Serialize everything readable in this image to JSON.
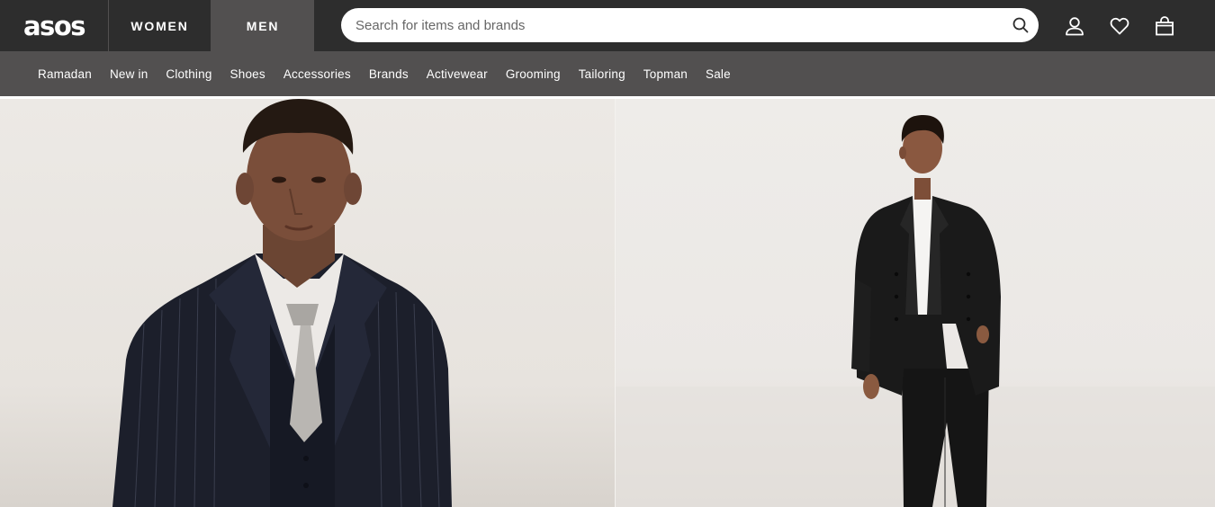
{
  "header": {
    "logo_text": "asos",
    "gender_tabs": [
      "WOMEN",
      "MEN"
    ],
    "active_gender": "MEN"
  },
  "search": {
    "placeholder": "Search for items and brands",
    "value": ""
  },
  "icons": {
    "search": "search-icon",
    "account": "account-icon",
    "saved": "heart-icon",
    "bag": "bag-icon"
  },
  "category_nav": {
    "items": [
      "Ramadan",
      "New in",
      "Clothing",
      "Shoes",
      "Accessories",
      "Brands",
      "Activewear",
      "Grooming",
      "Tailoring",
      "Topman",
      "Sale"
    ]
  },
  "colors": {
    "topbar": "#2d2d2d",
    "catbar": "#525050",
    "active_tab": "#525050"
  }
}
